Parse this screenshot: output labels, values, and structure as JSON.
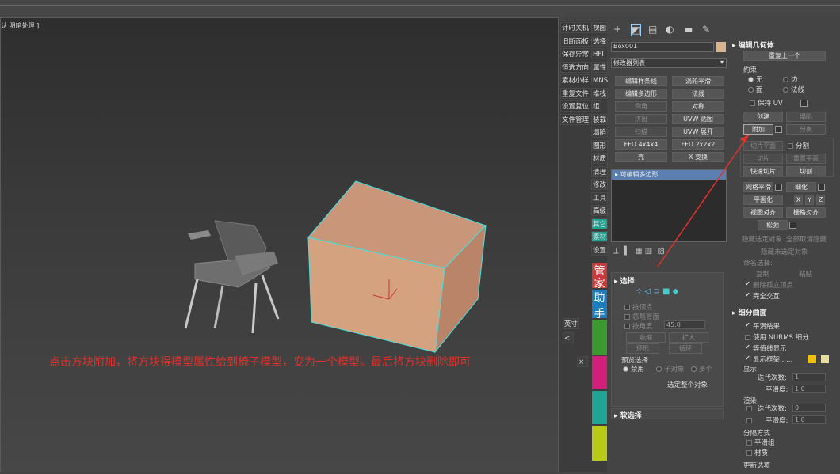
{
  "viewport": {
    "label": "认 明暗处理 ]",
    "instruction": "点击方块附加，将方块得模型属性给到椅子模型，变为一个模型。最后将方块删除即可"
  },
  "leftcol": {
    "items": [
      [
        "计时关机",
        "视图"
      ],
      [
        "旧断面板",
        "选择"
      ],
      [
        "保存异常",
        "HFI"
      ],
      [
        "恒选方向",
        "属性"
      ],
      [
        "素材小样",
        "MNS"
      ],
      [
        "重复文件",
        "堆栈"
      ],
      [
        "设置复位",
        "组"
      ],
      [
        "文件管理",
        "装载"
      ]
    ],
    "right_extra": [
      "塌陷",
      "图形",
      "材质",
      "清理",
      "修改",
      "工具",
      "高级",
      "其它",
      "素材",
      "设置"
    ],
    "helper": [
      "管",
      "家",
      "助",
      "手"
    ],
    "misc": [
      "英寸"
    ]
  },
  "cmd": {
    "object_name": "Box001",
    "modifier_list": "修改器列表",
    "buttons": [
      [
        "编辑样条线",
        "涡轮平滑"
      ],
      [
        "编辑多边形",
        "法线"
      ],
      [
        "倒角",
        "对称"
      ],
      [
        "挤出",
        "UVW 贴图"
      ],
      [
        "扫描",
        "UVW 展开"
      ],
      [
        "FFD 4x4x4",
        "FFD 2x2x2"
      ],
      [
        "壳",
        "X 变换"
      ]
    ],
    "stack_item": "可编辑多边形"
  },
  "selection": {
    "title": "选择",
    "by_vertex": "按顶点",
    "ignore_back": "忽略背面",
    "by_angle": "按角度",
    "angle_val": "45.0",
    "shrink": "收缩",
    "grow": "扩大",
    "ring": "环形",
    "loop": "循环",
    "preview": "预览选择",
    "disable": "禁用",
    "subobj": "子对象",
    "multi": "多个",
    "select_all": "选定整个对象",
    "soft": "软选择"
  },
  "edit": {
    "title": "编辑几何体",
    "repeat": "重复上一个",
    "constraint": "约束",
    "none": "无",
    "edge": "边",
    "face": "面",
    "normal": "法线",
    "keep_uv": "保持 UV",
    "create": "创建",
    "collapse": "塌陷",
    "attach": "附加",
    "detach": "分离",
    "slice_plane": "切片平面",
    "split": "分割",
    "slice": "切片",
    "reset_plane": "重置平面",
    "quick_slice": "快速切片",
    "cut": "切割",
    "meshsmooth": "网格平滑",
    "tessellate": "细化",
    "planarize": "平面化",
    "x": "X",
    "y": "Y",
    "z": "Z",
    "view_align": "视图对齐",
    "grid_align": "栅格对齐",
    "relax": "松弛",
    "hide_sel": "隐藏选定对象",
    "unhide_all": "全部取消隐藏",
    "hide_unsel": "隐藏未选定对象",
    "named_sel": "命名选择:",
    "copy": "复制",
    "paste": "粘贴",
    "del_iso": "删除孤立顶点",
    "full_inter": "完全交互"
  },
  "subdiv": {
    "title": "细分曲面",
    "smooth_result": "平滑结果",
    "use_nurms": "使用 NURMS 细分",
    "isoline": "等值线显示",
    "show_cage": "显示框架......",
    "display": "显示",
    "iterations": "迭代次数:",
    "iter_val": "1",
    "smoothness": "平滑度:",
    "smooth_val": "1.0",
    "render": "渲染",
    "r_iter_val": "0",
    "r_smooth_val": "1.0",
    "sep": "分隔方式",
    "smooth_groups": "平滑组",
    "materials": "材质",
    "update": "更新选项"
  },
  "colors": {
    "accent": "#e2312b",
    "box": "#d4a27e",
    "swatch": "#d8b48f",
    "sel": "#5a7fb0",
    "cage1": "#f2c200",
    "cage2": "#e8dca0"
  }
}
